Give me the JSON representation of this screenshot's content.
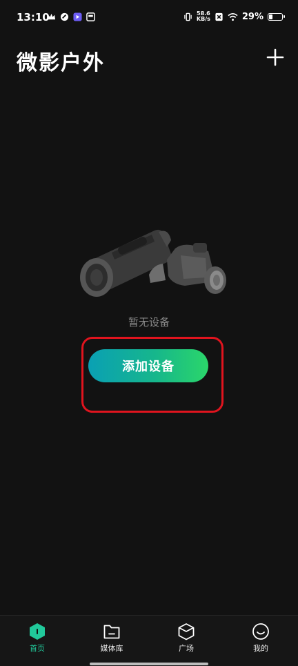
{
  "status_bar": {
    "time": "13:10",
    "network_speed_value": "58.6",
    "network_speed_unit": "KB/s",
    "battery_percent": "29%",
    "battery_level": 0.29,
    "icons": [
      "crown-icon",
      "app-icon",
      "play-icon",
      "store-icon",
      "vibrate-icon",
      "no-sim-icon",
      "wifi-icon",
      "battery-icon"
    ]
  },
  "header": {
    "title": "微影户外",
    "add_icon": "plus-icon"
  },
  "empty_state": {
    "illustration": "binoculars-monocular-illustration",
    "message": "暂无设备",
    "button_label": "添加设备"
  },
  "colors": {
    "background": "#121212",
    "accent": "#21c99b",
    "button_gradient_start": "#0aa0b4",
    "button_gradient_end": "#2bd66a",
    "highlight": "#e0141e"
  },
  "bottom_nav": {
    "items": [
      {
        "label": "首页",
        "icon": "home-icon",
        "active": true
      },
      {
        "label": "媒体库",
        "icon": "folder-icon",
        "active": false
      },
      {
        "label": "广场",
        "icon": "cube-icon",
        "active": false
      },
      {
        "label": "我的",
        "icon": "smile-icon",
        "active": false
      }
    ]
  }
}
